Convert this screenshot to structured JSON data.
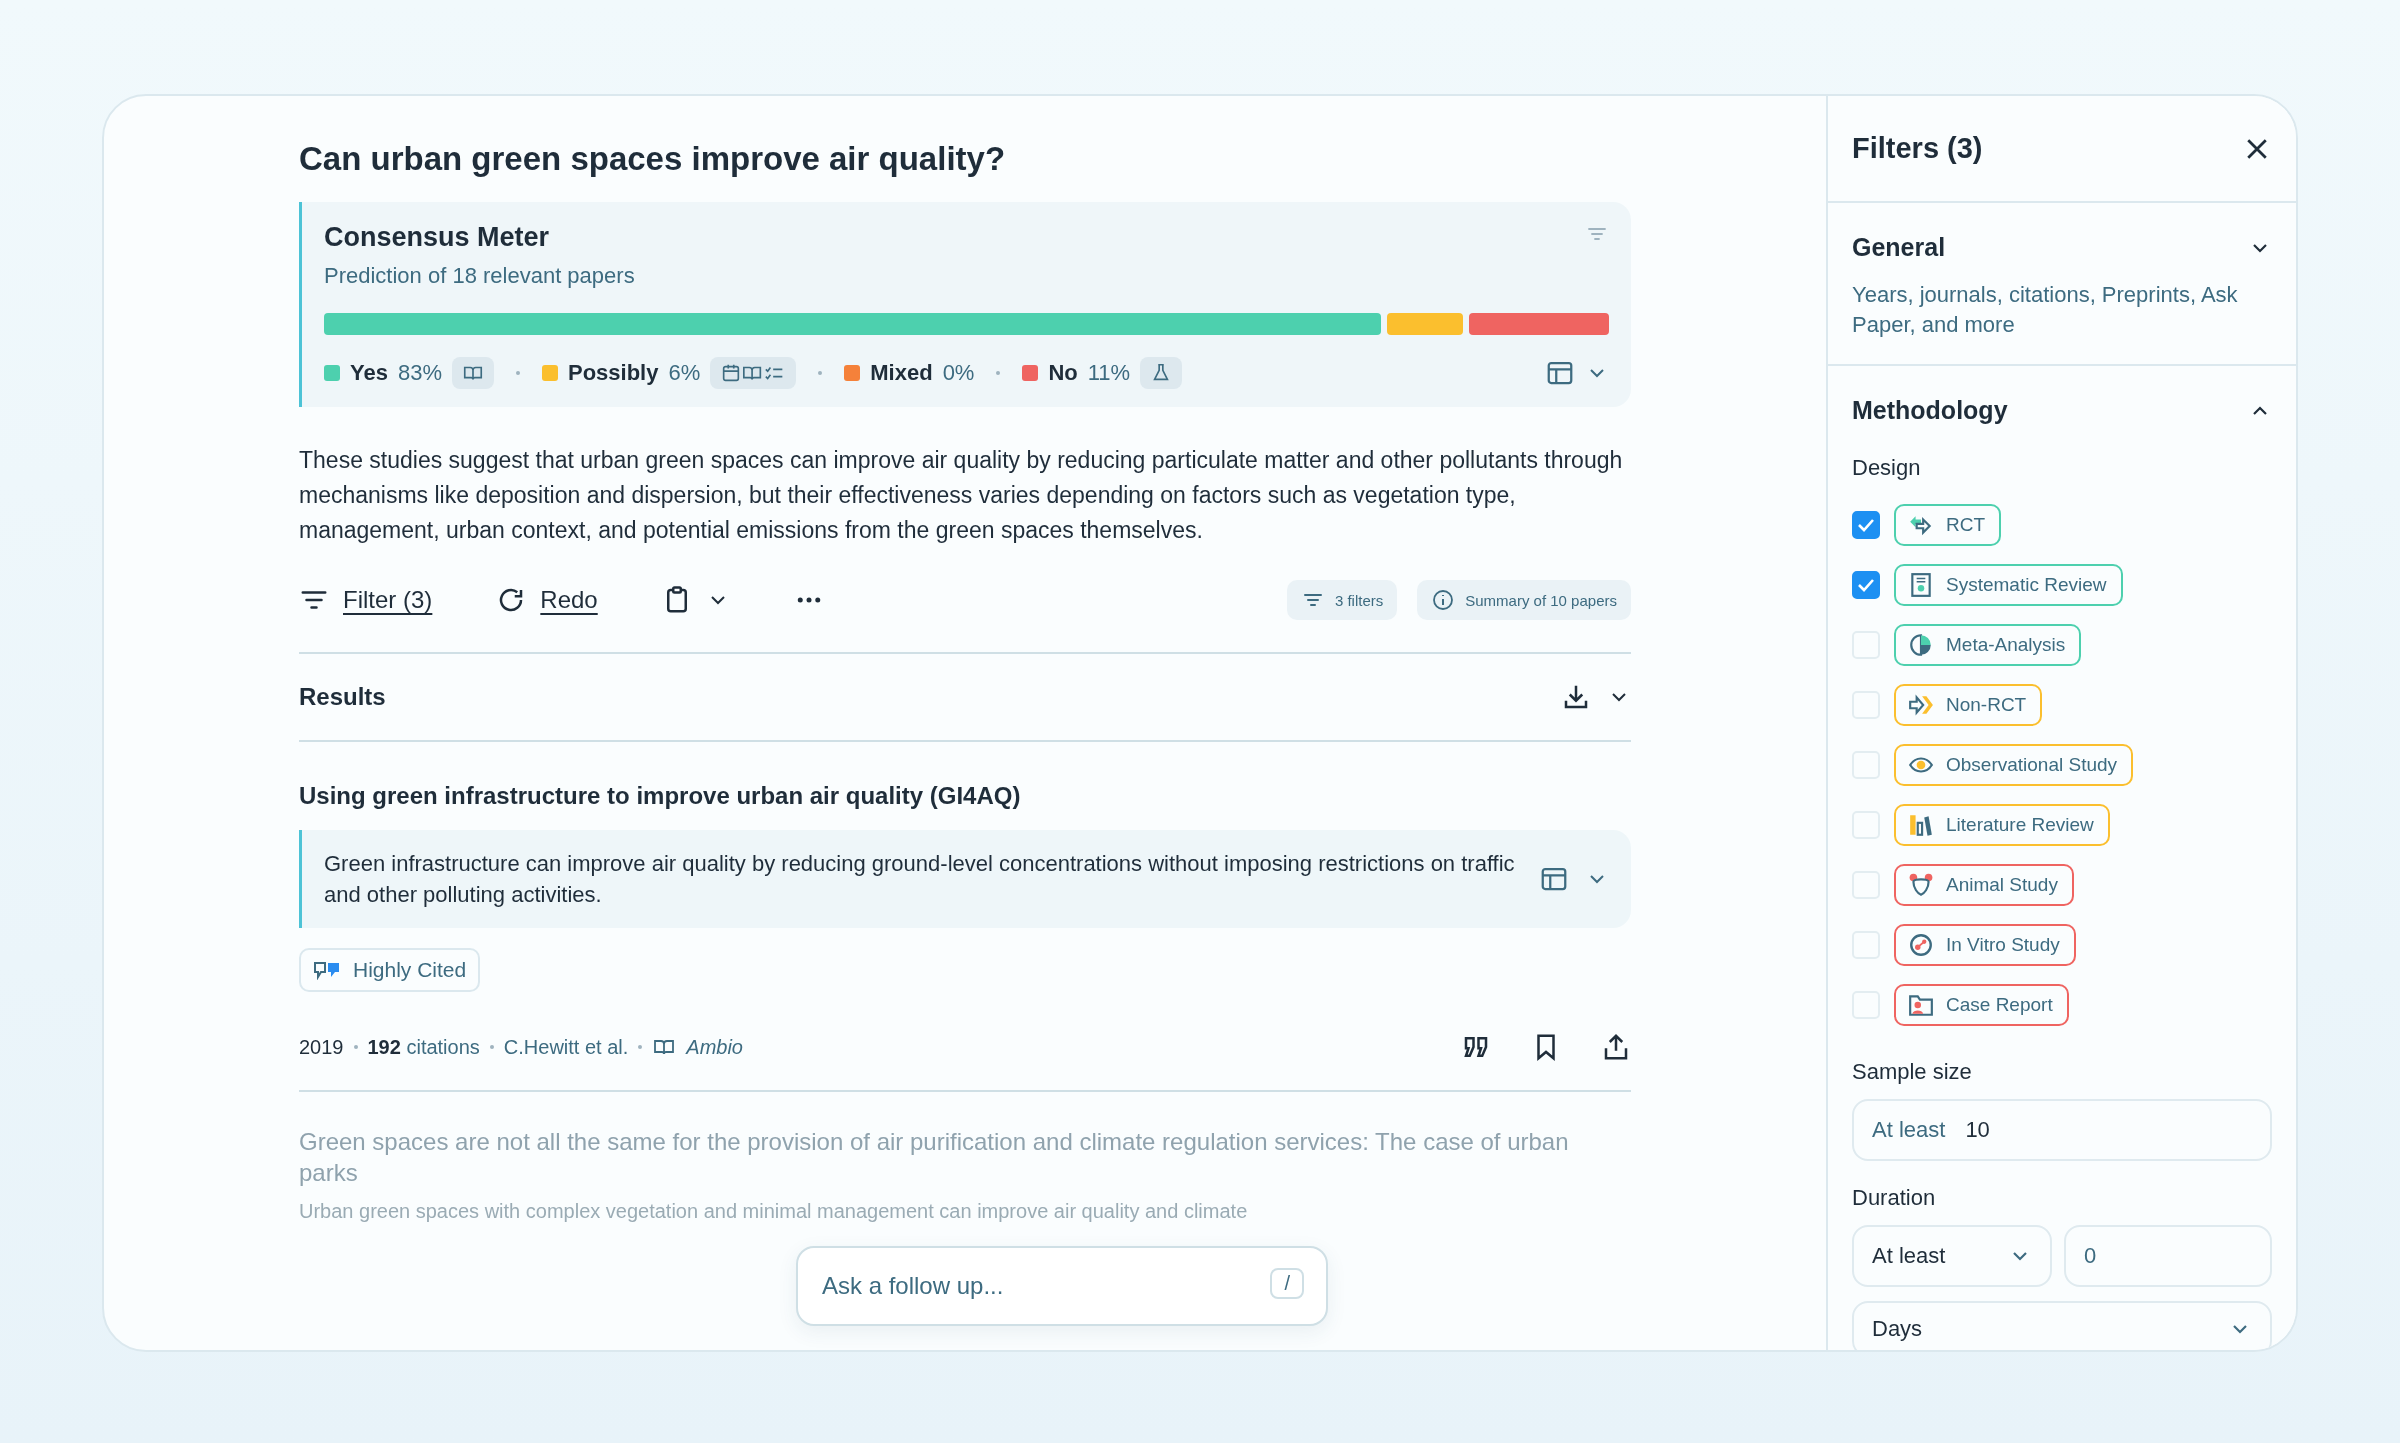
{
  "question": "Can urban green spaces improve air quality?",
  "consensus": {
    "title": "Consensus Meter",
    "subtitle": "Prediction of 18 relevant papers",
    "answers": [
      {
        "label": "Yes",
        "percent": "83%",
        "color": "#4dd0ae"
      },
      {
        "label": "Possibly",
        "percent": "6%",
        "color": "#fbbf2e"
      },
      {
        "label": "Mixed",
        "percent": "0%",
        "color": "#f5813a"
      },
      {
        "label": "No",
        "percent": "11%",
        "color": "#ef6461"
      }
    ]
  },
  "summary": "These studies suggest that urban green spaces can improve air quality by reducing particulate matter and other pollutants through mechanisms like deposition and dispersion, but their effectiveness varies depending on factors such as vegetation type, management, urban context, and potential emissions from the green spaces themselves.",
  "toolbar": {
    "filter_link": "Filter (3)",
    "redo_link": "Redo",
    "filters_chip": "3 filters",
    "summary_chip": "Summary of 10 papers"
  },
  "results": {
    "heading": "Results",
    "papers": [
      {
        "title": "Using green infrastructure to improve urban air quality (GI4AQ)",
        "summary": "Green infrastructure can improve air quality by reducing ground-level concentrations without imposing restrictions on traffic and other polluting activities.",
        "badge": "Highly Cited",
        "year": "2019",
        "citations_count": "192",
        "citations_label": "citations",
        "authors": "C.Hewitt et al.",
        "journal": "Ambio"
      },
      {
        "title": "Green spaces are not all the same for the provision of air purification and climate regulation services: The case of urban parks",
        "summary": "Urban green spaces with complex vegetation and minimal management can improve air quality and climate"
      }
    ]
  },
  "follow_up": {
    "placeholder": "Ask a follow up...",
    "shortcut": "/"
  },
  "filters": {
    "title": "Filters (3)",
    "general": {
      "heading": "General",
      "expanded": false,
      "description": "Years, journals, citations, Preprints, Ask Paper, and more"
    },
    "methodology": {
      "heading": "Methodology",
      "expanded": true,
      "design_label": "Design",
      "designs": [
        {
          "label": "RCT",
          "kind": "rct",
          "color": "#4dd0ae",
          "checked": true
        },
        {
          "label": "Systematic Review",
          "kind": "systematic",
          "color": "#4dd0ae",
          "checked": true
        },
        {
          "label": "Meta-Analysis",
          "kind": "meta",
          "color": "#4dd0ae",
          "checked": false
        },
        {
          "label": "Non-RCT",
          "kind": "nonrct",
          "color": "#fbbf2e",
          "checked": false
        },
        {
          "label": "Observational Study",
          "kind": "observational",
          "color": "#fbbf2e",
          "checked": false
        },
        {
          "label": "Literature Review",
          "kind": "literature",
          "color": "#fbbf2e",
          "checked": false
        },
        {
          "label": "Animal Study",
          "kind": "animal",
          "color": "#ef6461",
          "checked": false
        },
        {
          "label": "In Vitro Study",
          "kind": "invitro",
          "color": "#ef6461",
          "checked": false
        },
        {
          "label": "Case Report",
          "kind": "case",
          "color": "#ef6461",
          "checked": false
        }
      ],
      "sample_size": {
        "label": "Sample size",
        "prefix": "At least",
        "value": "10"
      },
      "duration": {
        "label": "Duration",
        "operator": "At least",
        "value": "0",
        "unit": "Days"
      }
    }
  }
}
